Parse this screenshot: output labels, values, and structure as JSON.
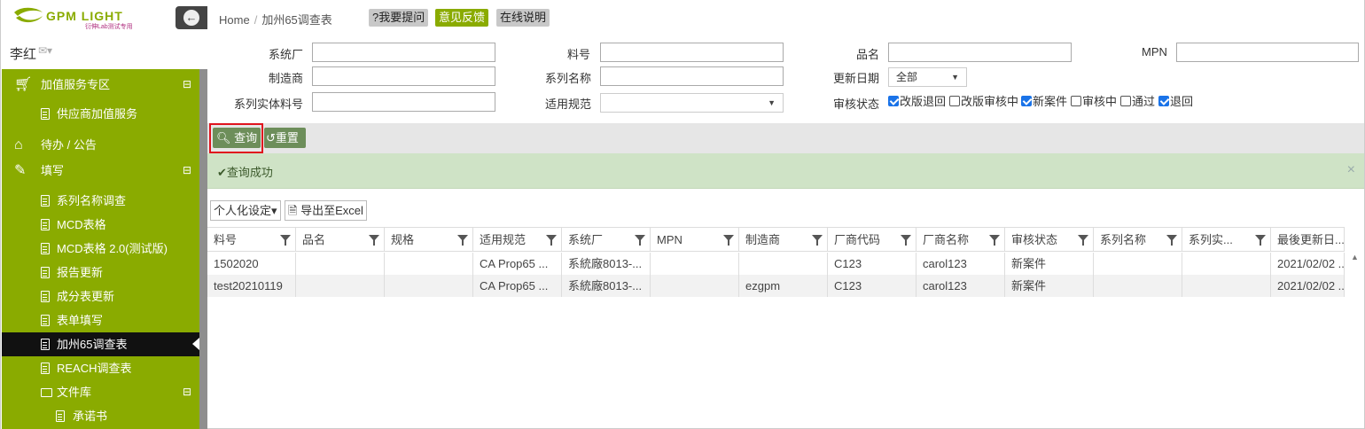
{
  "app": {
    "logo_text": "GPM LIGHT",
    "logo_subtext": "衍伸Lab测试专用",
    "user_name": "李红",
    "env_icon": "envelope-icon"
  },
  "menu": [
    {
      "label": "加值服务专区",
      "icon": "shopping-cart-icon",
      "expand": "⊟",
      "level": 0
    },
    {
      "label": "供应商加值服务",
      "icon": "document-icon",
      "level": 1
    },
    {
      "label": "待办 / 公告",
      "icon": "home-icon",
      "level": 0
    },
    {
      "label": "填写",
      "icon": "edit-icon",
      "expand": "⊟",
      "level": 0
    },
    {
      "label": "系列名称调查",
      "icon": "document-icon",
      "level": 1
    },
    {
      "label": "MCD表格",
      "icon": "document-icon",
      "level": 1
    },
    {
      "label": "MCD表格 2.0(测试版)",
      "icon": "document-icon",
      "level": 1
    },
    {
      "label": "报告更新",
      "icon": "document-icon",
      "level": 1
    },
    {
      "label": "成分表更新",
      "icon": "document-icon",
      "level": 1
    },
    {
      "label": "表单填写",
      "icon": "document-icon",
      "level": 1
    },
    {
      "label": "加州65调查表",
      "icon": "document-icon",
      "level": 1,
      "active": true
    },
    {
      "label": "REACH调查表",
      "icon": "document-icon",
      "level": 1
    },
    {
      "label": "文件库",
      "icon": "folder-icon",
      "expand": "⊟",
      "level": 1
    },
    {
      "label": "承诺书",
      "icon": "document-icon",
      "level": 2
    }
  ],
  "breadcrumb": {
    "home": "Home",
    "sep": "/",
    "current": "加州65调查表"
  },
  "header_buttons": {
    "ask": "?我要提问",
    "feedback": "意见反馈",
    "help": "在线说明"
  },
  "filters": {
    "system_factory_label": "系统厂",
    "part_no_label": "料号",
    "product_name_label": "品名",
    "mpn_label": "MPN",
    "manufacturer_label": "制造商",
    "series_name_label": "系列名称",
    "update_date_label": "更新日期",
    "update_date_value": "全部",
    "series_part_label": "系列实体料号",
    "spec_label": "适用规范",
    "spec_value": "",
    "review_status_label": "审核状态",
    "review_options": [
      {
        "label": "改版退回",
        "checked": true
      },
      {
        "label": "改版审核中",
        "checked": false
      },
      {
        "label": "新案件",
        "checked": true
      },
      {
        "label": "审核中",
        "checked": false
      },
      {
        "label": "通过",
        "checked": false
      },
      {
        "label": "退回",
        "checked": true
      }
    ]
  },
  "actions": {
    "query": "查询",
    "reset": "重置"
  },
  "alert": {
    "text": "查询成功",
    "close": "×"
  },
  "grid_toolbar": {
    "personal": "个人化设定",
    "export": "导出至Excel"
  },
  "grid": {
    "columns": [
      "料号",
      "品名",
      "规格",
      "适用规范",
      "系统厂",
      "MPN",
      "制造商",
      "厂商代码",
      "厂商名称",
      "审核状态",
      "系列名称",
      "系列实...",
      "最後更新日..."
    ],
    "rows": [
      [
        "1502020",
        "",
        "",
        "CA Prop65 ...",
        "系統廠8013-...",
        "",
        "",
        "C123",
        "carol123",
        "新案件",
        "",
        "",
        "2021/02/02 ..."
      ],
      [
        "test20210119",
        "",
        "",
        "CA Prop65 ...",
        "系統廠8013-...",
        "",
        "ezgpm",
        "C123",
        "carol123",
        "新案件",
        "",
        "",
        "2021/02/02 ..."
      ]
    ]
  }
}
